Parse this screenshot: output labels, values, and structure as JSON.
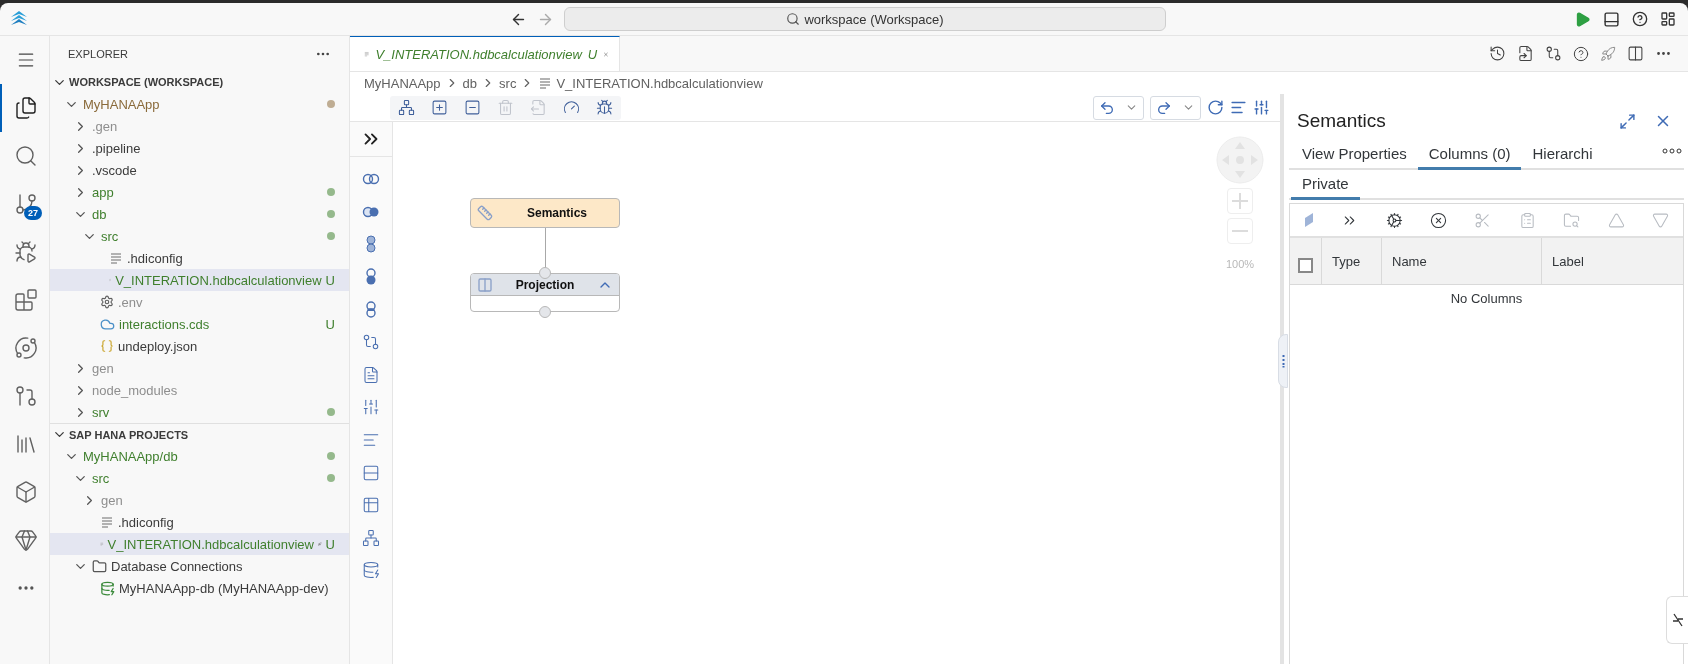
{
  "title_bar": {
    "search": "workspace (Workspace)"
  },
  "activity_bar": {
    "items": [
      {
        "kind": "explorer",
        "selected": true
      },
      {
        "kind": "search",
        "selected": false
      },
      {
        "kind": "source-control",
        "selected": false,
        "badge": "27"
      },
      {
        "kind": "run",
        "selected": false
      },
      {
        "kind": "extensions",
        "selected": false
      },
      {
        "kind": "orbit",
        "selected": false
      },
      {
        "kind": "pull-request",
        "selected": false
      },
      {
        "kind": "library",
        "selected": false
      },
      {
        "kind": "cube",
        "selected": false
      },
      {
        "kind": "gem",
        "selected": false
      }
    ]
  },
  "explorer": {
    "title": "EXPLORER",
    "sections": [
      {
        "title": "WORKSPACE (WORKSPACE)",
        "expanded": true,
        "items": [
          {
            "label": "MyHANAApp",
            "kind": "folder",
            "expanded": true,
            "color": "#8a6a3a",
            "dot": true,
            "selected": false,
            "children": [
              {
                "label": ".gen",
                "kind": "folder",
                "expanded": false,
                "color": "#8e8e8e",
                "dot": false,
                "selected": false
              },
              {
                "label": ".pipeline",
                "kind": "folder",
                "expanded": false,
                "color": "#3b3b3b",
                "dot": false,
                "selected": false
              },
              {
                "label": ".vscode",
                "kind": "folder",
                "expanded": false,
                "color": "#3b3b3b",
                "dot": false,
                "selected": false
              },
              {
                "label": "app",
                "kind": "folder",
                "expanded": false,
                "color": "#3f7f2d",
                "dot": true,
                "selected": false
              },
              {
                "label": "db",
                "kind": "folder",
                "expanded": true,
                "color": "#3f7f2d",
                "dot": true,
                "selected": false,
                "children": [
                  {
                    "label": "src",
                    "kind": "folder",
                    "expanded": true,
                    "color": "#3f7f2d",
                    "dot": true,
                    "selected": false,
                    "children": [
                      {
                        "label": ".hdiconfig",
                        "kind": "file",
                        "color": "#3b3b3b",
                        "dot": false,
                        "selected": false
                      },
                      {
                        "label": "V_INTERATION.hdbcalculationview",
                        "kind": "file",
                        "color": "#3f7f2d",
                        "badge": "U",
                        "dot": false,
                        "selected": true
                      }
                    ]
                  },
                  {
                    "label": ".env",
                    "kind": "config",
                    "color": "#8e8e8e",
                    "dot": false,
                    "selected": false
                  },
                  {
                    "label": "interactions.cds",
                    "kind": "cds",
                    "color": "#3f7f2d",
                    "badge": "U",
                    "dot": false,
                    "selected": false
                  },
                  {
                    "label": "undeploy.json",
                    "kind": "json",
                    "color": "#3b3b3b",
                    "dot": false,
                    "selected": false
                  }
                ]
              },
              {
                "label": "gen",
                "kind": "folder",
                "expanded": false,
                "color": "#8e8e8e",
                "dot": false,
                "selected": false
              },
              {
                "label": "node_modules",
                "kind": "folder",
                "expanded": false,
                "color": "#8e8e8e",
                "dot": false,
                "selected": false
              },
              {
                "label": "srv",
                "kind": "folder",
                "expanded": false,
                "color": "#3f7f2d",
                "dot": true,
                "selected": false
              }
            ]
          }
        ]
      },
      {
        "title": "SAP HANA PROJECTS",
        "expanded": true,
        "items": [
          {
            "label": "MyHANAApp/db",
            "kind": "folder",
            "expanded": true,
            "color": "#3f7f2d",
            "dot": true,
            "selected": false,
            "children": [
              {
                "label": "src",
                "kind": "folder",
                "expanded": true,
                "color": "#3f7f2d",
                "dot": true,
                "selected": false,
                "children": [
                  {
                    "label": "gen",
                    "kind": "folder",
                    "expanded": false,
                    "color": "#8e8e8e",
                    "dot": false,
                    "selected": false
                  },
                  {
                    "label": ".hdiconfig",
                    "kind": "file",
                    "color": "#3b3b3b",
                    "dot": false,
                    "selected": false
                  },
                  {
                    "label": "V_INTERATION.hdbcalculationview",
                    "kind": "file",
                    "color": "#3f7f2d",
                    "badge": "U",
                    "dot": false,
                    "selected": true,
                    "deploy_action": true
                  }
                ]
              },
              {
                "label": "Database Connections",
                "kind": "connections",
                "expanded": true,
                "color": "#3b3b3b",
                "dot": false,
                "selected": false,
                "children": [
                  {
                    "label": "MyHANAApp-db (MyHANAApp-dev)",
                    "kind": "connection",
                    "color": "#3b3b3b",
                    "dot": false,
                    "selected": false
                  }
                ]
              }
            ]
          }
        ]
      }
    ]
  },
  "editor": {
    "tabs": [
      {
        "label": "V_INTERATION.hdbcalculationview",
        "badge": "U",
        "selected": true
      }
    ],
    "breadcrumb": [
      "MyHANAApp",
      "db",
      "src",
      "V_INTERATION.hdbcalculationview"
    ],
    "toolbar": [
      {
        "kind": "hierarchy",
        "disabled": false
      },
      {
        "kind": "add",
        "disabled": false
      },
      {
        "kind": "remove",
        "disabled": false
      },
      {
        "kind": "delete",
        "disabled": true
      },
      {
        "kind": "export",
        "disabled": true
      },
      {
        "kind": "performance",
        "disabled": false
      },
      {
        "kind": "debug",
        "disabled": false
      }
    ],
    "canvas": {
      "nodes": [
        {
          "label": "Semantics",
          "kind": "semantics"
        },
        {
          "label": "Projection",
          "kind": "projection",
          "expanded": true
        }
      ],
      "zoom": "100%"
    }
  },
  "semantics_panel": {
    "title": "Semantics",
    "tabs": [
      {
        "label": "View Properties",
        "selected": false
      },
      {
        "label": "Columns (0)",
        "selected": true
      },
      {
        "label": "Hierarchi",
        "selected": false
      }
    ],
    "subtabs": [
      {
        "label": "Private",
        "selected": true
      }
    ],
    "toolbar": [
      {
        "kind": "marker",
        "disabled": false
      },
      {
        "kind": "expand",
        "disabled": false
      },
      {
        "kind": "settings",
        "disabled": false
      },
      {
        "kind": "remove",
        "disabled": false
      },
      {
        "kind": "cut",
        "disabled": true
      },
      {
        "kind": "paste",
        "disabled": true
      },
      {
        "kind": "find",
        "disabled": true
      },
      {
        "kind": "up",
        "disabled": true
      },
      {
        "kind": "down",
        "disabled": true
      }
    ],
    "table": {
      "checked": false,
      "columns": [
        "Type",
        "Name",
        "Label"
      ],
      "empty_text": "No Columns"
    }
  }
}
